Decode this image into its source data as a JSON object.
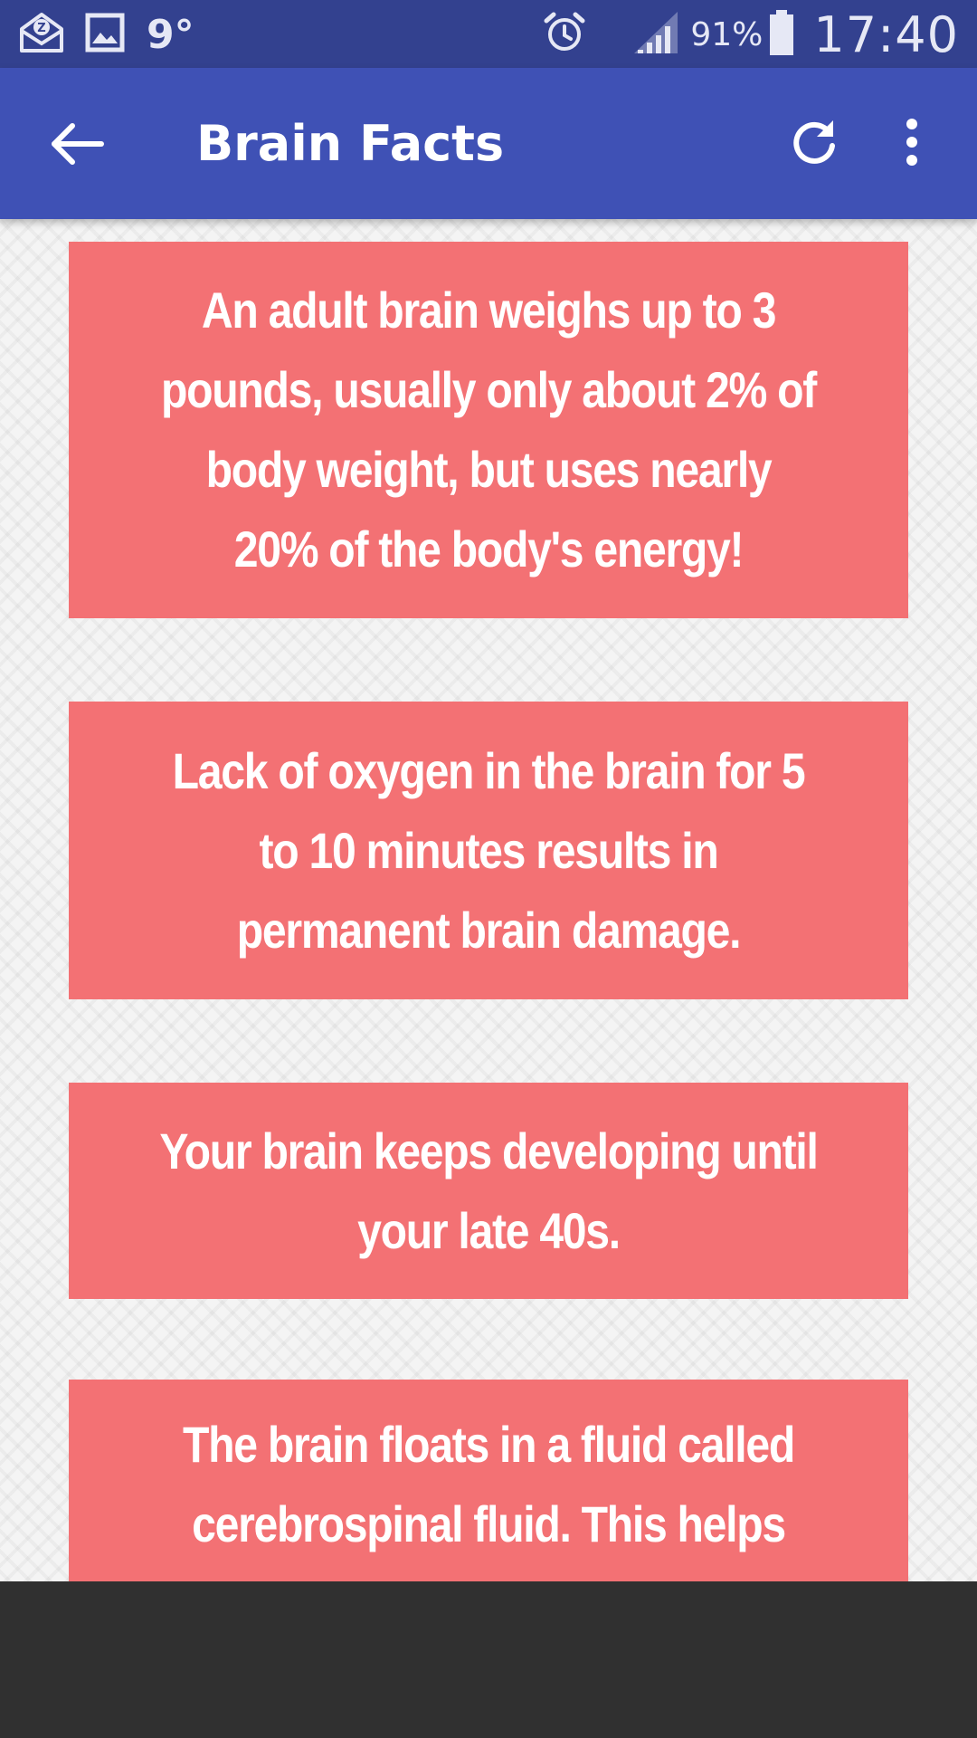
{
  "status_bar": {
    "temperature": "9°",
    "battery_percent": "91%",
    "time": "17:40",
    "icons": [
      "notification-icon",
      "gallery-icon",
      "alarm-icon",
      "signal-icon",
      "battery-icon"
    ]
  },
  "app_bar": {
    "title": "Brain Facts",
    "background_color": "#3f51b5",
    "icons": [
      "arrow-back-icon",
      "refresh-icon",
      "more-vert-icon"
    ]
  },
  "facts": [
    {
      "text": "An adult brain weighs up to 3 pounds, usually only about 2% of body weight, but uses nearly 20% of the body's energy!"
    },
    {
      "text": "Lack of oxygen in the brain for 5 to 10 minutes results in permanent brain damage."
    },
    {
      "text": "Your brain keeps developing until your late 40s."
    },
    {
      "text": "The brain floats in a fluid called cerebrospinal fluid. This helps"
    }
  ],
  "colors": {
    "card_background": "#f37174",
    "status_bar": "#33418f",
    "bottom_bar": "#303030"
  }
}
